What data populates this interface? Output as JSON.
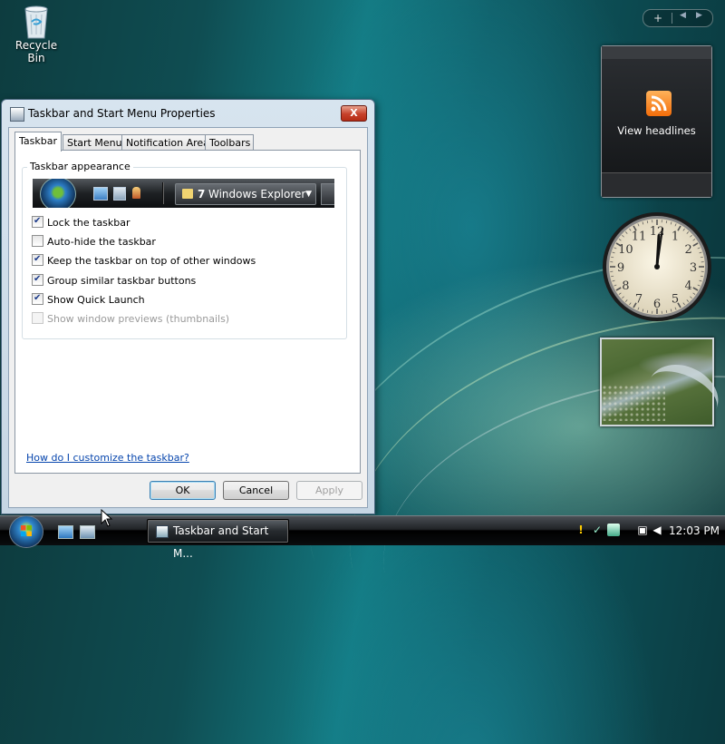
{
  "desktop": {
    "recycle_bin_label": "Recycle Bin"
  },
  "window": {
    "title": "Taskbar and Start Menu Properties",
    "close_glyph": "X",
    "tabs": [
      {
        "label": "Taskbar",
        "active": true
      },
      {
        "label": "Start Menu",
        "active": false
      },
      {
        "label": "Notification Area",
        "active": false
      },
      {
        "label": "Toolbars",
        "active": false
      }
    ],
    "group_label": "Taskbar appearance",
    "preview": {
      "button_number": "7",
      "button_text": "Windows Explorer",
      "button_arrow": "▼"
    },
    "options": [
      {
        "label": "Lock the taskbar",
        "checked": true,
        "enabled": true
      },
      {
        "label": "Auto-hide the taskbar",
        "checked": false,
        "enabled": true
      },
      {
        "label": "Keep the taskbar on top of other windows",
        "checked": true,
        "enabled": true
      },
      {
        "label": "Group similar taskbar buttons",
        "checked": true,
        "enabled": true
      },
      {
        "label": "Show Quick Launch",
        "checked": true,
        "enabled": true
      },
      {
        "label": "Show window previews (thumbnails)",
        "checked": false,
        "enabled": false
      }
    ],
    "help_link": "How do I customize the taskbar?",
    "buttons": {
      "ok": "OK",
      "cancel": "Cancel",
      "apply": "Apply"
    }
  },
  "sidebar": {
    "toolbar": {
      "add_glyph": "+",
      "prev_glyph": "◀",
      "next_glyph": "▶"
    },
    "feed_gadget_text": "View headlines",
    "clock_numbers": [
      "12",
      "1",
      "2",
      "3",
      "4",
      "5",
      "6",
      "7",
      "8",
      "9",
      "10",
      "11"
    ]
  },
  "taskbar": {
    "task_button_label": "Taskbar and Start M...",
    "clock": "12:03 PM"
  },
  "colors": {
    "accent_close": "#c6402a",
    "link": "#0645ad",
    "rss": "#f36d0a"
  }
}
